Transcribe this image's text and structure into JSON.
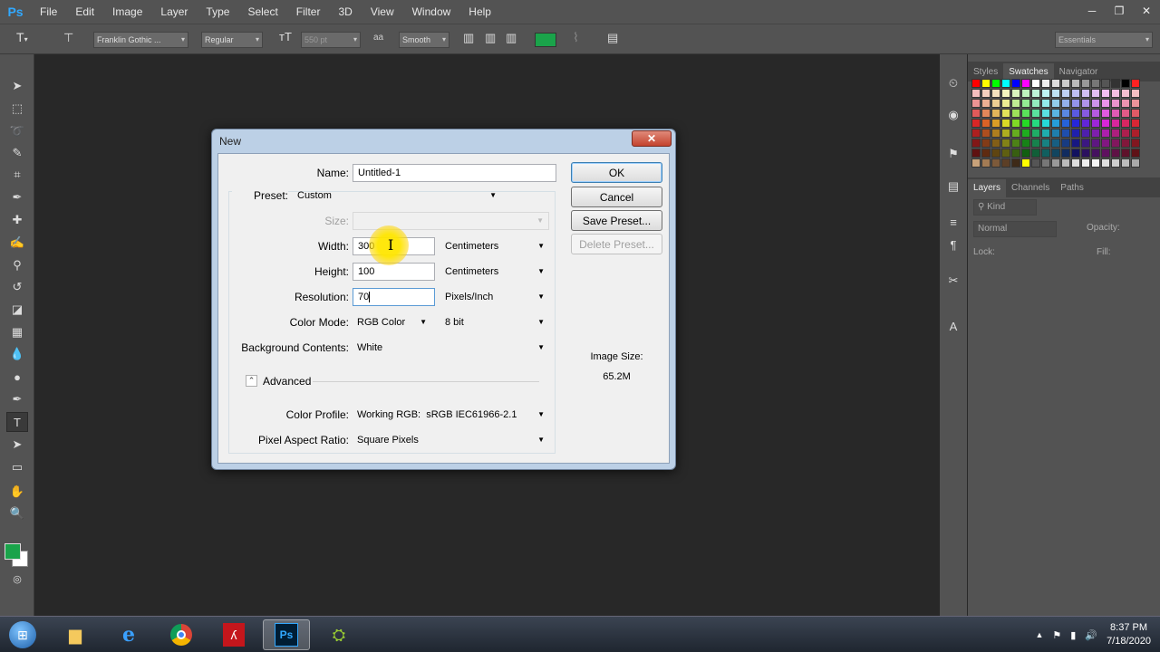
{
  "menubar": {
    "logo": "Ps",
    "items": [
      "File",
      "Edit",
      "Image",
      "Layer",
      "Type",
      "Select",
      "Filter",
      "3D",
      "View",
      "Window",
      "Help"
    ],
    "window_controls": [
      "─",
      "❐",
      "✕"
    ]
  },
  "options_bar": {
    "font_family": "Franklin Gothic ...",
    "font_style": "Regular",
    "font_size": "550 pt",
    "antialias_label": "aa",
    "antialias": "Smooth",
    "text_color": "#1aa34a",
    "workspace": "Essentials"
  },
  "colors": {
    "foreground": "#1aa34a",
    "background": "#ffffff"
  },
  "right_panels": {
    "top_tabs": [
      "Styles",
      "Swatches",
      "Navigator"
    ],
    "active_top_tab": "Swatches",
    "layer_tabs": [
      "Layers",
      "Channels",
      "Paths"
    ],
    "kind_filter": "Kind",
    "blend_mode": "Normal",
    "opacity_label": "Opacity:",
    "lock_label": "Lock:",
    "fill_label": "Fill:"
  },
  "dialog": {
    "title": "New",
    "close_label": "✕",
    "name_label": "Name:",
    "name_value": "Untitled-1",
    "preset_label": "Preset:",
    "preset_value": "Custom",
    "size_label": "Size:",
    "width_label": "Width:",
    "width_value": "300",
    "width_unit": "Centimeters",
    "height_label": "Height:",
    "height_value": "100",
    "height_unit": "Centimeters",
    "resolution_label": "Resolution:",
    "resolution_value": "70",
    "resolution_unit": "Pixels/Inch",
    "color_mode_label": "Color Mode:",
    "color_mode_value": "RGB Color",
    "bit_depth": "8 bit",
    "background_label": "Background Contents:",
    "background_value": "White",
    "advanced_label": "Advanced",
    "color_profile_label": "Color Profile:",
    "color_profile_value": "Working RGB:  sRGB IEC61966-2.1",
    "pixel_aspect_label": "Pixel Aspect Ratio:",
    "pixel_aspect_value": "Square Pixels",
    "ok_label": "OK",
    "cancel_label": "Cancel",
    "save_preset_label": "Save Preset...",
    "delete_preset_label": "Delete Preset...",
    "image_size_label": "Image Size:",
    "image_size_value": "65.2M"
  },
  "taskbar": {
    "time": "8:37 PM",
    "date": "7/18/2020"
  }
}
